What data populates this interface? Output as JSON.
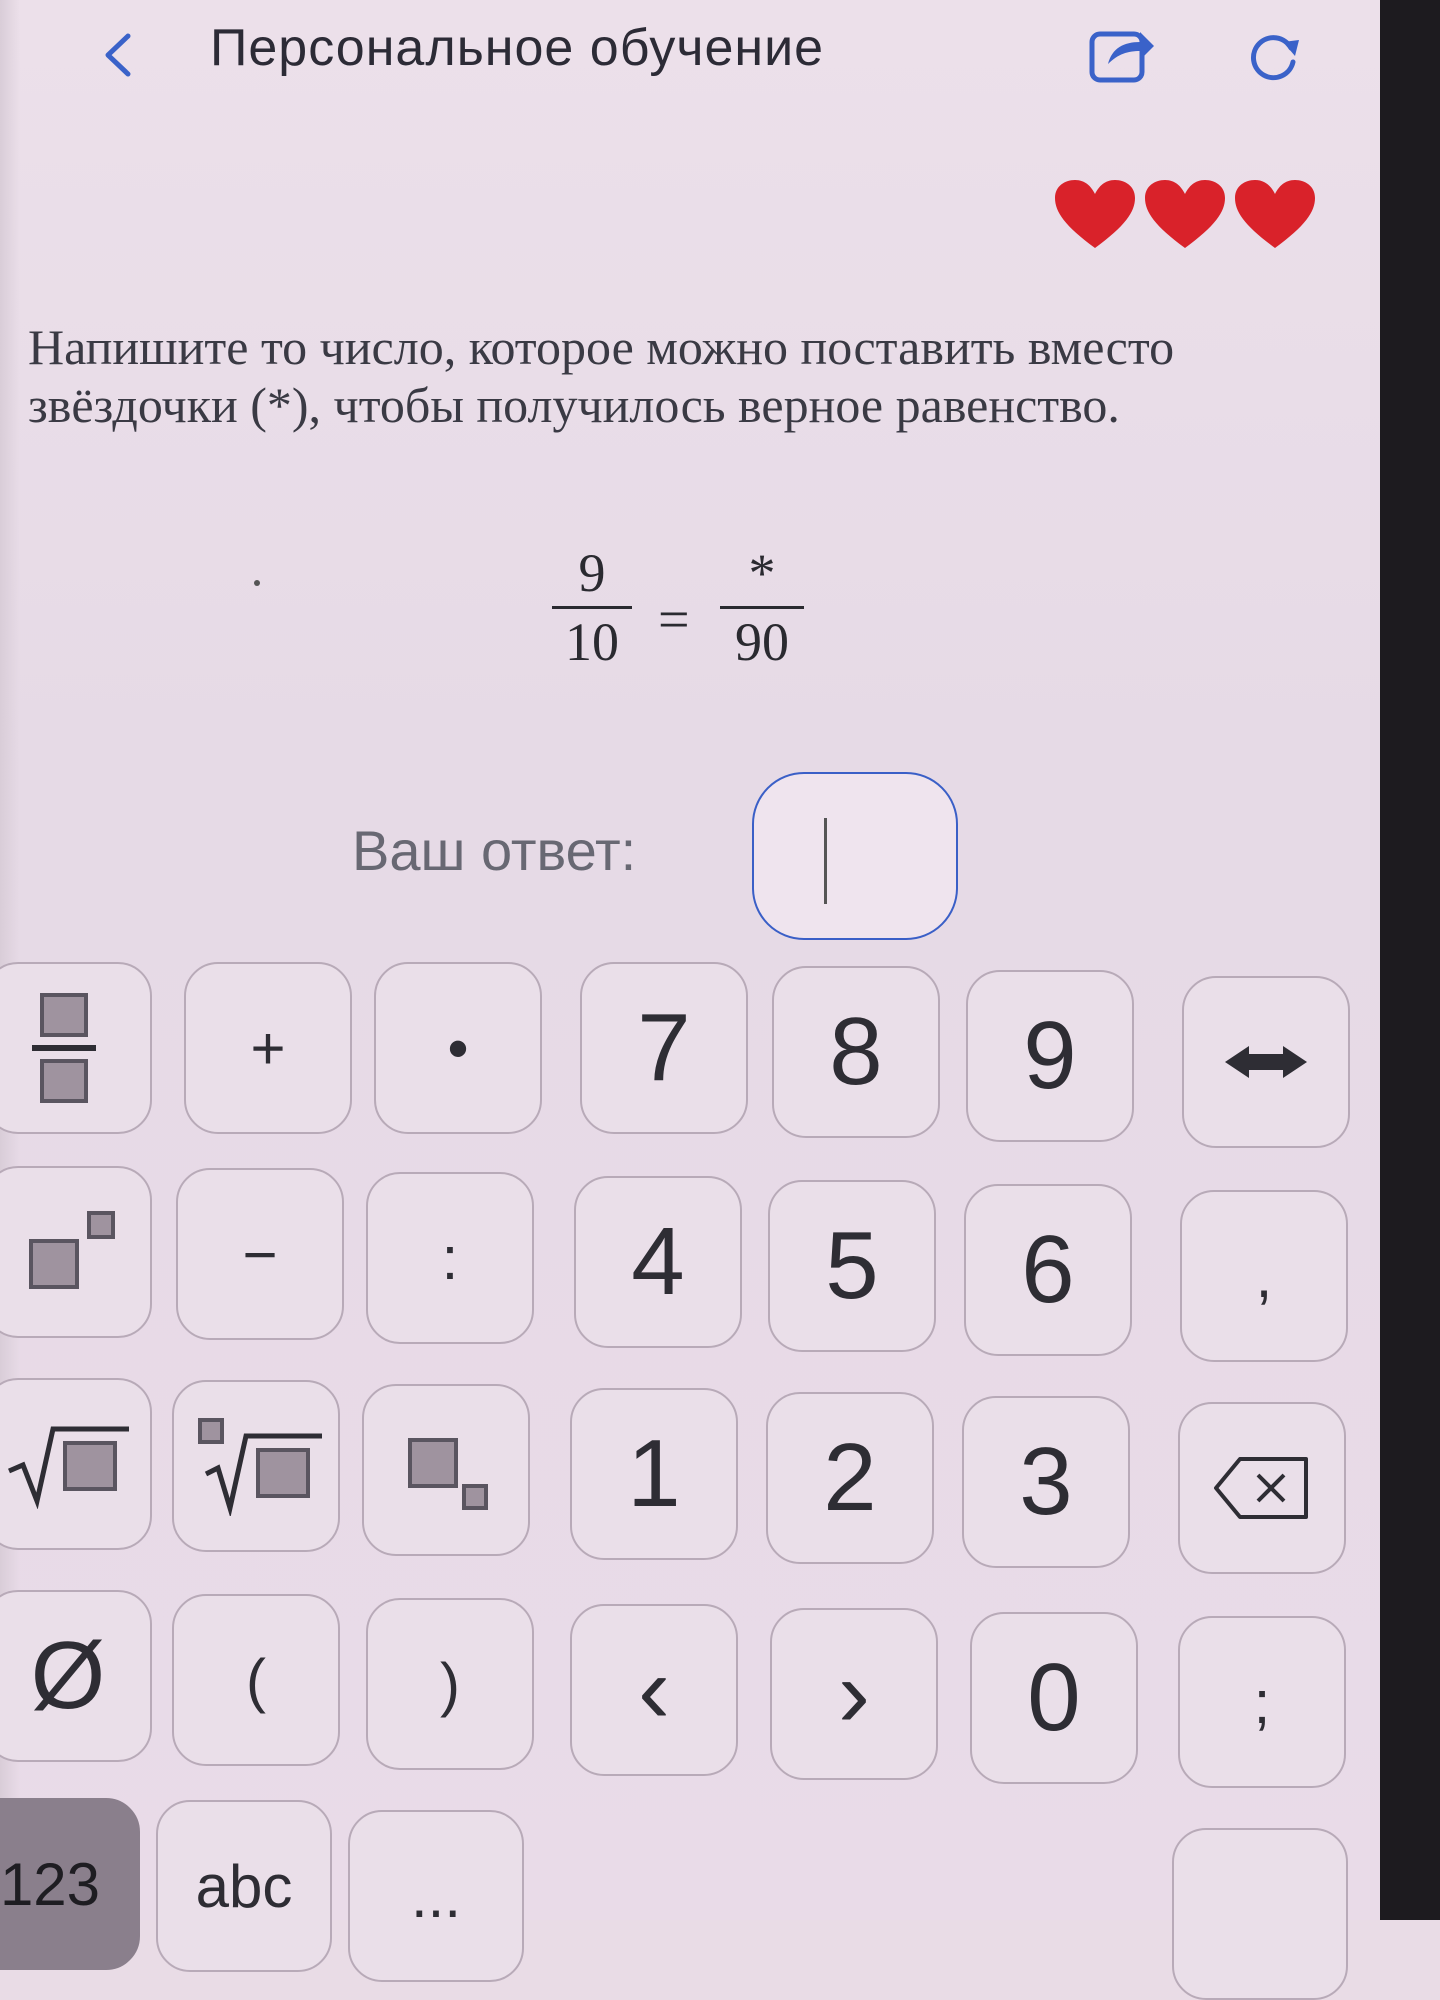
{
  "header": {
    "title": "Персональное обучение",
    "icons": [
      "back-chevron-icon",
      "share-icon",
      "refresh-icon"
    ]
  },
  "lives": {
    "count": 3,
    "color": "#d9222a"
  },
  "question": {
    "text": "Напишите то число, которое можно поставить вместо звёздочки (*), чтобы получилось верное равенство.",
    "equation": {
      "left_num": "9",
      "left_den": "10",
      "sign": "=",
      "right_num": "*",
      "right_den": "90"
    }
  },
  "answer": {
    "label": "Ваш ответ:",
    "value": ""
  },
  "keyboard": {
    "row1": [
      "fraction",
      "+",
      "•",
      "7",
      "8",
      "9",
      "arrows"
    ],
    "row2": [
      "power",
      "−",
      ":",
      "4",
      "5",
      "6",
      ","
    ],
    "row3": [
      "sqrt",
      "nth-root",
      "subscript",
      "1",
      "2",
      "3",
      "backspace"
    ],
    "row4": [
      "Ø",
      "(",
      ")",
      "‹",
      "›",
      "0",
      ";"
    ],
    "row5": [
      "123",
      "abc",
      "..."
    ],
    "labels": {
      "plus": "+",
      "dot": "•",
      "minus": "−",
      "colon": ":",
      "comma": ",",
      "empty": "Ø",
      "lparen": "(",
      "rparen": ")",
      "left": "‹",
      "right": "›",
      "semicolon": ";",
      "d7": "7",
      "d8": "8",
      "d9": "9",
      "d4": "4",
      "d5": "5",
      "d6": "6",
      "d1": "1",
      "d2": "2",
      "d3": "3",
      "d0": "0",
      "mode123": "123",
      "modeabc": "abc",
      "more": "..."
    }
  }
}
